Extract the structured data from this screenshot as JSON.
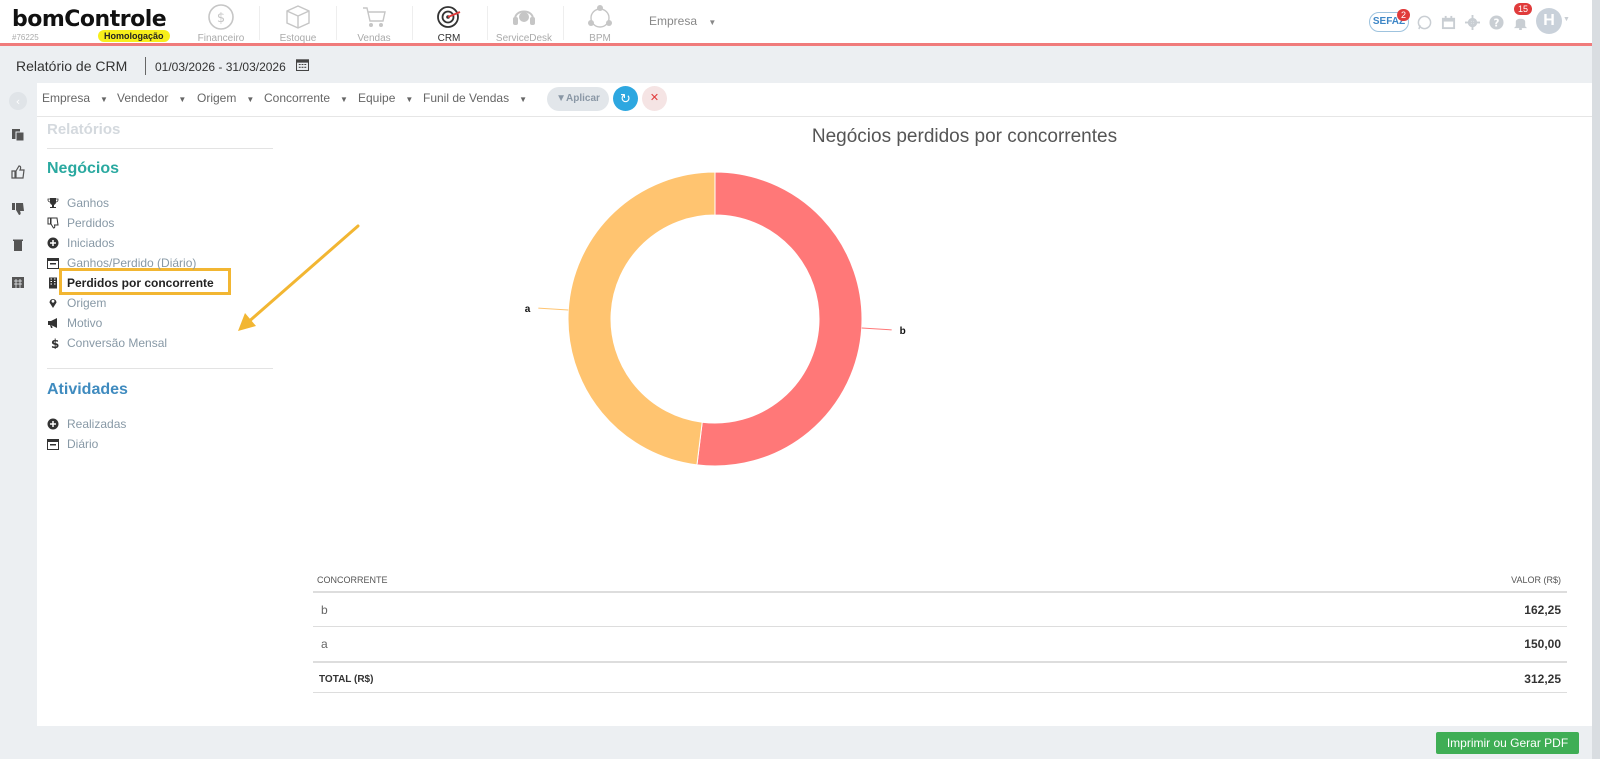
{
  "app": {
    "logo_text": "bomControle",
    "account_id": "#76225",
    "env_badge": "Homologação"
  },
  "nav": {
    "modules": [
      {
        "label": "Financeiro",
        "icon": "dollar-circle-icon"
      },
      {
        "label": "Estoque",
        "icon": "box-icon"
      },
      {
        "label": "Vendas",
        "icon": "cart-icon"
      },
      {
        "label": "CRM",
        "icon": "crm-target-icon"
      },
      {
        "label": "ServiceDesk",
        "icon": "headset-icon"
      },
      {
        "label": "BPM",
        "icon": "bpm-cycle-icon"
      }
    ],
    "empresa_label": "Empresa",
    "sefaz_label": "SEFAZ",
    "sefaz_count": "2",
    "notif_count": "15",
    "avatar_letter": "H"
  },
  "header": {
    "title": "Relatório de CRM",
    "date_range": "01/03/2026 - 31/03/2026"
  },
  "filters": {
    "items": [
      "Empresa",
      "Vendedor",
      "Origem",
      "Concorrente",
      "Equipe",
      "Funil de Vendas"
    ],
    "apply_label": "Aplicar"
  },
  "sidebar": {
    "heading": "Relatórios",
    "negocios": {
      "title": "Negócios",
      "items": [
        {
          "label": "Ganhos",
          "icon": "trophy-icon"
        },
        {
          "label": "Perdidos",
          "icon": "thumbs-down-icon"
        },
        {
          "label": "Iniciados",
          "icon": "plus-circle-icon"
        },
        {
          "label": "Ganhos/Perdido (Diário)",
          "icon": "calendar-icon"
        },
        {
          "label": "Perdidos por concorrente",
          "icon": "building-icon"
        },
        {
          "label": "Origem",
          "icon": "map-marker-icon"
        },
        {
          "label": "Motivo",
          "icon": "bullhorn-icon"
        },
        {
          "label": "Conversão Mensal",
          "icon": "dollar-icon"
        }
      ],
      "selected_index": 4
    },
    "atividades": {
      "title": "Atividades",
      "items": [
        {
          "label": "Realizadas",
          "icon": "plus-circle-icon"
        },
        {
          "label": "Diário",
          "icon": "calendar-icon"
        }
      ]
    }
  },
  "chart_data": {
    "type": "pie",
    "title": "Negócios perdidos por concorrentes",
    "donut": true,
    "categories": [
      "b",
      "a"
    ],
    "values": [
      162.25,
      150.0
    ],
    "colors": [
      "#ff7878",
      "#ffc470"
    ]
  },
  "table": {
    "headers": [
      "CONCORRENTE",
      "VALOR (R$)"
    ],
    "rows": [
      {
        "name": "b",
        "value": "162,25"
      },
      {
        "name": "a",
        "value": "150,00"
      }
    ],
    "total_label": "TOTAL (R$)",
    "total_value": "312,25"
  },
  "footer": {
    "pdf_button": "Imprimir ou Gerar PDF"
  }
}
